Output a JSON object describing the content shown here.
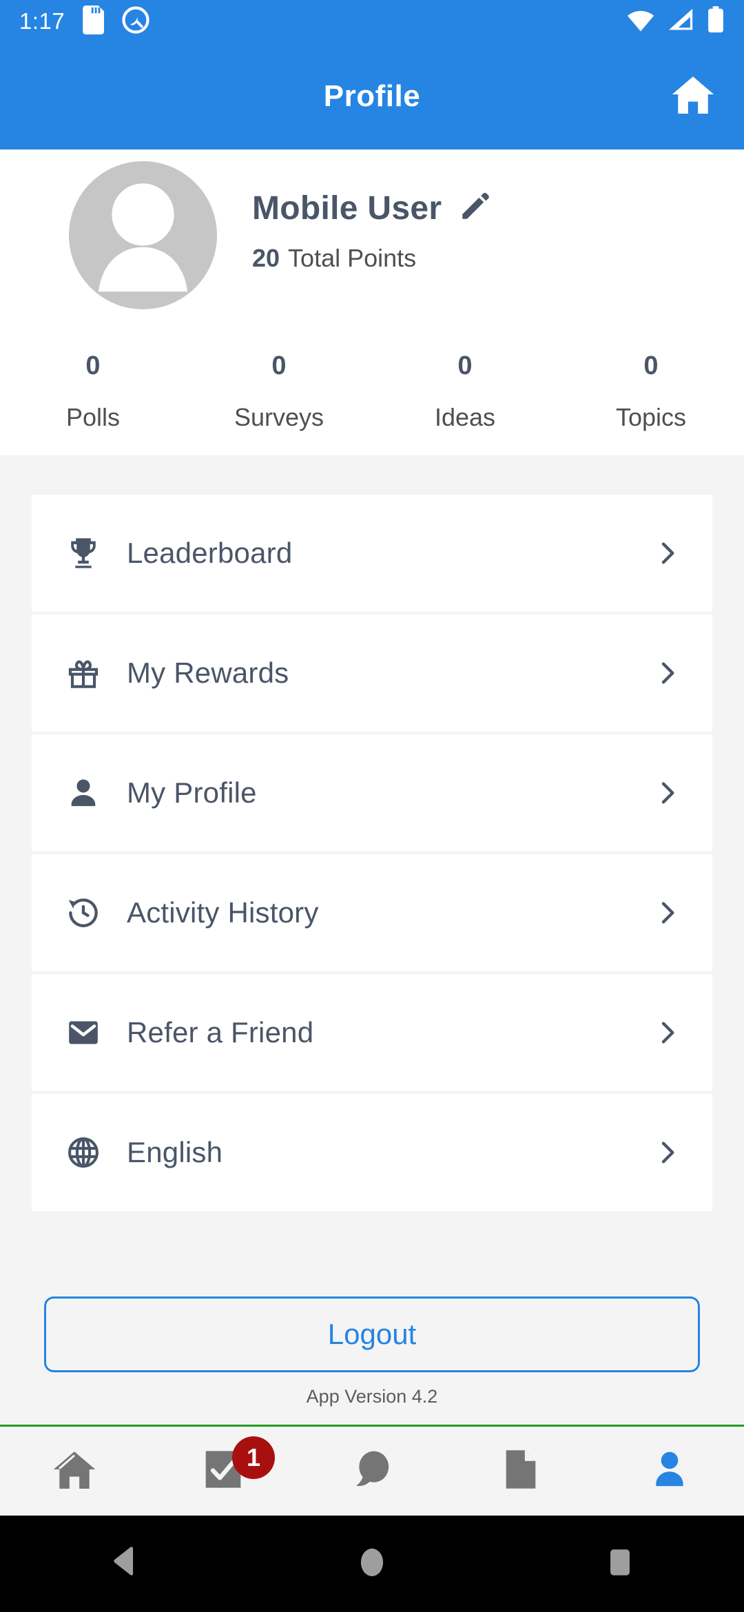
{
  "statusbar": {
    "time": "1:17",
    "left_icons": [
      "sd-card-icon",
      "android-q-icon"
    ],
    "right_icons": [
      "wifi-icon",
      "cellular-signal-icon",
      "battery-icon"
    ]
  },
  "appbar": {
    "title": "Profile",
    "home_icon": "home-icon",
    "background": "#2684E3"
  },
  "profile": {
    "avatar_icon": "default-avatar-icon",
    "name": "Mobile User",
    "edit_icon": "pencil-icon",
    "points_value": "20",
    "points_label": "Total Points",
    "stats": [
      {
        "value": "0",
        "label": "Polls"
      },
      {
        "value": "0",
        "label": "Surveys"
      },
      {
        "value": "0",
        "label": "Ideas"
      },
      {
        "value": "0",
        "label": "Topics"
      }
    ]
  },
  "menu": {
    "items": [
      {
        "label": "Leaderboard",
        "icon": "trophy-icon"
      },
      {
        "label": "My Rewards",
        "icon": "gift-icon"
      },
      {
        "label": "My Profile",
        "icon": "person-icon"
      },
      {
        "label": "Activity History",
        "icon": "history-icon"
      },
      {
        "label": "Refer a Friend",
        "icon": "envelope-icon"
      },
      {
        "label": "English",
        "icon": "globe-icon"
      }
    ],
    "chevron_icon": "chevron-right-icon"
  },
  "logout": {
    "label": "Logout",
    "accent_color": "#2684E3"
  },
  "footer": {
    "version_text": "App Version 4.2"
  },
  "bottomnav": {
    "separator_color": "#1E9E1E",
    "active_color": "#2684E3",
    "inactive_color": "#757575",
    "badge_color": "#A81010",
    "items": [
      {
        "name": "home",
        "icon": "home-icon",
        "active": false,
        "badge": ""
      },
      {
        "name": "tasks",
        "icon": "checklist-icon",
        "active": false,
        "badge": "1"
      },
      {
        "name": "chat",
        "icon": "chat-icon",
        "active": false,
        "badge": ""
      },
      {
        "name": "documents",
        "icon": "document-icon",
        "active": false,
        "badge": ""
      },
      {
        "name": "profile",
        "icon": "person-icon",
        "active": true,
        "badge": ""
      }
    ]
  },
  "androidnav": {
    "items": [
      {
        "name": "back",
        "icon": "back-triangle-icon"
      },
      {
        "name": "home",
        "icon": "home-circle-icon"
      },
      {
        "name": "recents",
        "icon": "recents-square-icon"
      }
    ]
  }
}
